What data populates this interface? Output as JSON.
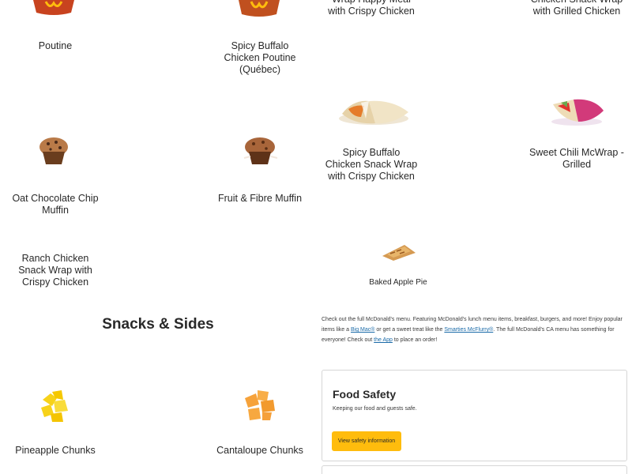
{
  "menu_items": {
    "poutine": "Poutine",
    "spicy_buffalo_poutine": "Spicy Buffalo Chicken Poutine (Québec)",
    "happy_meal_wrap": "Wrap Happy Meal with Crispy Chicken",
    "snack_wrap_grilled": "Chicken Snack Wrap with Grilled Chicken",
    "spicy_buffalo_snack_wrap": "Spicy Buffalo Chicken Snack Wrap with Crispy Chicken",
    "sweet_chili_mcwrap": "Sweet Chili McWrap - Grilled",
    "oat_muffin": "Oat Chocolate Chip Muffin",
    "fruit_muffin": "Fruit & Fibre Muffin",
    "ranch_wrap": "Ranch Chicken Snack Wrap with Crispy Chicken",
    "apple_pie": "Baked Apple Pie",
    "pineapple": "Pineapple Chunks",
    "cantaloupe": "Cantaloupe Chunks"
  },
  "section": {
    "title": "Snacks & Sides"
  },
  "description": {
    "part1": "Check out the full McDonald's menu. Featuring McDonald's lunch menu items, breakfast, burgers, and more! Enjoy popular items like a ",
    "link_bigmac": "Big Mac®",
    "part2": " or get a sweet treat like the ",
    "link_mcflurry": "Smarties McFlurry®",
    "part3": ". The full McDonald's CA menu has something for everyone! Check out ",
    "link_app": "the App",
    "part4": " to place an order!"
  },
  "food_safety": {
    "title": "Food Safety",
    "subtitle": "Keeping our food and guests safe.",
    "button": "View safety information"
  },
  "colors": {
    "accent": "#ffbc0d",
    "link": "#1a6aa8",
    "text": "#292929"
  }
}
